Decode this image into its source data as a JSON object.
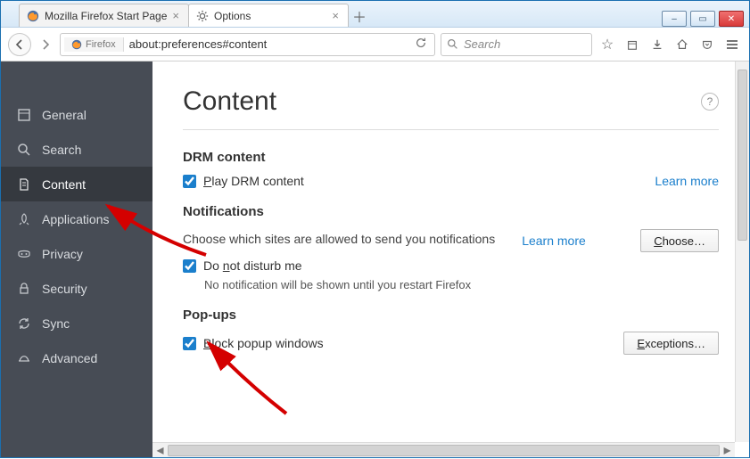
{
  "window": {
    "min_label": "–",
    "max_label": "▭",
    "close_label": "✕"
  },
  "tabs": [
    {
      "label": "Mozilla Firefox Start Page",
      "active": false
    },
    {
      "label": "Options",
      "active": true
    }
  ],
  "urlbar": {
    "identity_label": "Firefox",
    "url": "about:preferences#content"
  },
  "searchbar": {
    "placeholder": "Search"
  },
  "sidebar": {
    "items": [
      {
        "name": "general",
        "label": "General",
        "icon": "panel-icon"
      },
      {
        "name": "search",
        "label": "Search",
        "icon": "search-icon"
      },
      {
        "name": "content",
        "label": "Content",
        "icon": "document-icon",
        "active": true
      },
      {
        "name": "applications",
        "label": "Applications",
        "icon": "rocket-icon"
      },
      {
        "name": "privacy",
        "label": "Privacy",
        "icon": "mask-icon"
      },
      {
        "name": "security",
        "label": "Security",
        "icon": "lock-icon"
      },
      {
        "name": "sync",
        "label": "Sync",
        "icon": "sync-icon"
      },
      {
        "name": "advanced",
        "label": "Advanced",
        "icon": "hat-icon"
      }
    ]
  },
  "page": {
    "title": "Content",
    "sections": {
      "drm": {
        "heading": "DRM content",
        "play_label": "Play DRM content",
        "learn_more": "Learn more"
      },
      "notifications": {
        "heading": "Notifications",
        "desc": "Choose which sites are allowed to send you notifications",
        "learn_more": "Learn more",
        "choose_btn": "Choose…",
        "dnd_label": "Do not disturb me",
        "dnd_sub": "No notification will be shown until you restart Firefox"
      },
      "popups": {
        "heading": "Pop-ups",
        "block_label": "Block popup windows",
        "exceptions_btn": "Exceptions…"
      }
    }
  }
}
